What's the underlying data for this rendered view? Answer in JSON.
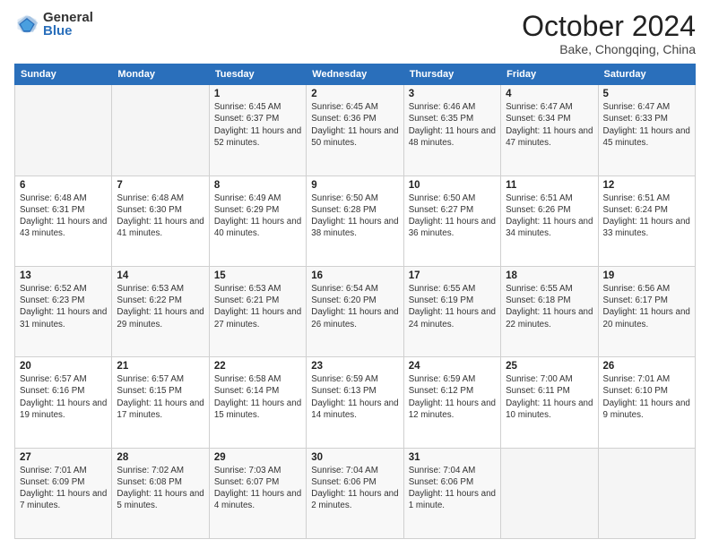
{
  "logo": {
    "general": "General",
    "blue": "Blue"
  },
  "title": {
    "month_year": "October 2024",
    "location": "Bake, Chongqing, China"
  },
  "weekdays": [
    "Sunday",
    "Monday",
    "Tuesday",
    "Wednesday",
    "Thursday",
    "Friday",
    "Saturday"
  ],
  "weeks": [
    [
      {
        "day": "",
        "info": ""
      },
      {
        "day": "",
        "info": ""
      },
      {
        "day": "1",
        "info": "Sunrise: 6:45 AM\nSunset: 6:37 PM\nDaylight: 11 hours and 52 minutes."
      },
      {
        "day": "2",
        "info": "Sunrise: 6:45 AM\nSunset: 6:36 PM\nDaylight: 11 hours and 50 minutes."
      },
      {
        "day": "3",
        "info": "Sunrise: 6:46 AM\nSunset: 6:35 PM\nDaylight: 11 hours and 48 minutes."
      },
      {
        "day": "4",
        "info": "Sunrise: 6:47 AM\nSunset: 6:34 PM\nDaylight: 11 hours and 47 minutes."
      },
      {
        "day": "5",
        "info": "Sunrise: 6:47 AM\nSunset: 6:33 PM\nDaylight: 11 hours and 45 minutes."
      }
    ],
    [
      {
        "day": "6",
        "info": "Sunrise: 6:48 AM\nSunset: 6:31 PM\nDaylight: 11 hours and 43 minutes."
      },
      {
        "day": "7",
        "info": "Sunrise: 6:48 AM\nSunset: 6:30 PM\nDaylight: 11 hours and 41 minutes."
      },
      {
        "day": "8",
        "info": "Sunrise: 6:49 AM\nSunset: 6:29 PM\nDaylight: 11 hours and 40 minutes."
      },
      {
        "day": "9",
        "info": "Sunrise: 6:50 AM\nSunset: 6:28 PM\nDaylight: 11 hours and 38 minutes."
      },
      {
        "day": "10",
        "info": "Sunrise: 6:50 AM\nSunset: 6:27 PM\nDaylight: 11 hours and 36 minutes."
      },
      {
        "day": "11",
        "info": "Sunrise: 6:51 AM\nSunset: 6:26 PM\nDaylight: 11 hours and 34 minutes."
      },
      {
        "day": "12",
        "info": "Sunrise: 6:51 AM\nSunset: 6:24 PM\nDaylight: 11 hours and 33 minutes."
      }
    ],
    [
      {
        "day": "13",
        "info": "Sunrise: 6:52 AM\nSunset: 6:23 PM\nDaylight: 11 hours and 31 minutes."
      },
      {
        "day": "14",
        "info": "Sunrise: 6:53 AM\nSunset: 6:22 PM\nDaylight: 11 hours and 29 minutes."
      },
      {
        "day": "15",
        "info": "Sunrise: 6:53 AM\nSunset: 6:21 PM\nDaylight: 11 hours and 27 minutes."
      },
      {
        "day": "16",
        "info": "Sunrise: 6:54 AM\nSunset: 6:20 PM\nDaylight: 11 hours and 26 minutes."
      },
      {
        "day": "17",
        "info": "Sunrise: 6:55 AM\nSunset: 6:19 PM\nDaylight: 11 hours and 24 minutes."
      },
      {
        "day": "18",
        "info": "Sunrise: 6:55 AM\nSunset: 6:18 PM\nDaylight: 11 hours and 22 minutes."
      },
      {
        "day": "19",
        "info": "Sunrise: 6:56 AM\nSunset: 6:17 PM\nDaylight: 11 hours and 20 minutes."
      }
    ],
    [
      {
        "day": "20",
        "info": "Sunrise: 6:57 AM\nSunset: 6:16 PM\nDaylight: 11 hours and 19 minutes."
      },
      {
        "day": "21",
        "info": "Sunrise: 6:57 AM\nSunset: 6:15 PM\nDaylight: 11 hours and 17 minutes."
      },
      {
        "day": "22",
        "info": "Sunrise: 6:58 AM\nSunset: 6:14 PM\nDaylight: 11 hours and 15 minutes."
      },
      {
        "day": "23",
        "info": "Sunrise: 6:59 AM\nSunset: 6:13 PM\nDaylight: 11 hours and 14 minutes."
      },
      {
        "day": "24",
        "info": "Sunrise: 6:59 AM\nSunset: 6:12 PM\nDaylight: 11 hours and 12 minutes."
      },
      {
        "day": "25",
        "info": "Sunrise: 7:00 AM\nSunset: 6:11 PM\nDaylight: 11 hours and 10 minutes."
      },
      {
        "day": "26",
        "info": "Sunrise: 7:01 AM\nSunset: 6:10 PM\nDaylight: 11 hours and 9 minutes."
      }
    ],
    [
      {
        "day": "27",
        "info": "Sunrise: 7:01 AM\nSunset: 6:09 PM\nDaylight: 11 hours and 7 minutes."
      },
      {
        "day": "28",
        "info": "Sunrise: 7:02 AM\nSunset: 6:08 PM\nDaylight: 11 hours and 5 minutes."
      },
      {
        "day": "29",
        "info": "Sunrise: 7:03 AM\nSunset: 6:07 PM\nDaylight: 11 hours and 4 minutes."
      },
      {
        "day": "30",
        "info": "Sunrise: 7:04 AM\nSunset: 6:06 PM\nDaylight: 11 hours and 2 minutes."
      },
      {
        "day": "31",
        "info": "Sunrise: 7:04 AM\nSunset: 6:06 PM\nDaylight: 11 hours and 1 minute."
      },
      {
        "day": "",
        "info": ""
      },
      {
        "day": "",
        "info": ""
      }
    ]
  ]
}
